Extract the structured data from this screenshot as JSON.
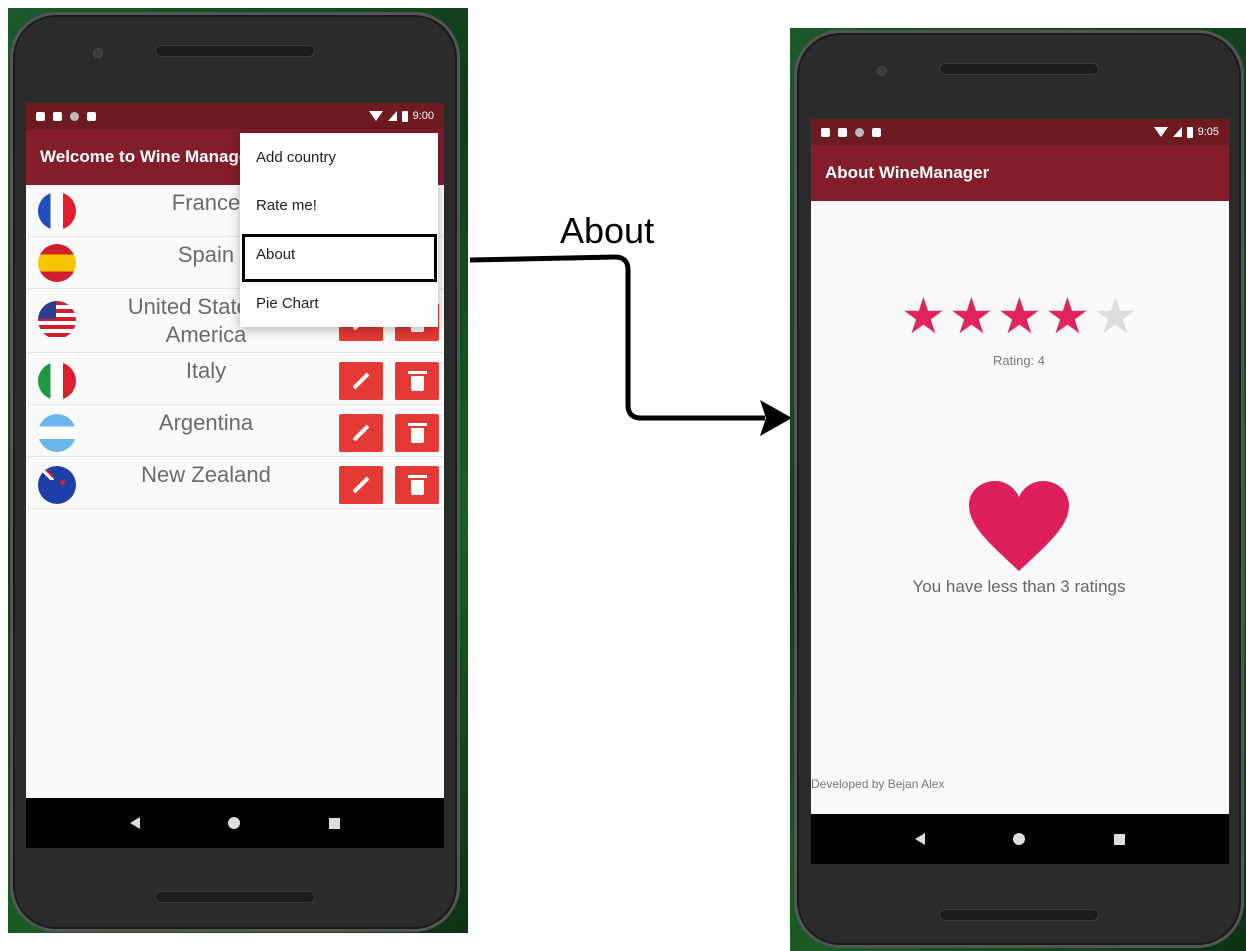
{
  "left_phone": {
    "status": {
      "time": "9:00"
    },
    "appbar": {
      "title": "Welcome to Wine Manager"
    },
    "countries": [
      {
        "name": "France",
        "flag": "france-flag"
      },
      {
        "name": "Spain",
        "flag": "spain-flag"
      },
      {
        "name": "United States of America",
        "flag": "usa-flag"
      },
      {
        "name": "Italy",
        "flag": "italy-flag"
      },
      {
        "name": "Argentina",
        "flag": "argentina-flag"
      },
      {
        "name": "New Zealand",
        "flag": "new-zealand-flag"
      }
    ],
    "menu": {
      "items": [
        "Add country",
        "Rate me!",
        "About",
        "Pie Chart"
      ]
    }
  },
  "arrow": {
    "label": "About"
  },
  "right_phone": {
    "status": {
      "time": "9:05"
    },
    "appbar": {
      "title": "About WineManager"
    },
    "rating": {
      "value": 4,
      "max": 5,
      "label": "Rating: 4",
      "filled_color": "#e0245e",
      "empty_color": "#dddddd"
    },
    "heart_color": "#dd1f5c",
    "ratings_message": "You have less than 3 ratings",
    "developer": "Developed by Bejan Alex"
  },
  "colors": {
    "statusbar": "#6d1a22",
    "appbar": "#831c2b",
    "action_button": "#e53935"
  }
}
